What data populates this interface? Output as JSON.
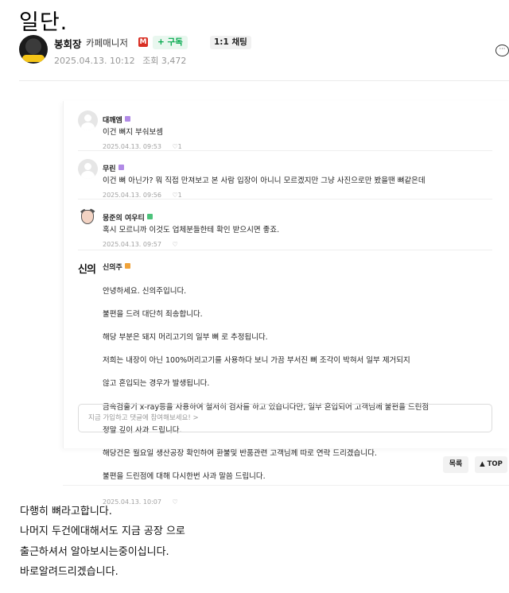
{
  "post": {
    "title": "일단.",
    "author": {
      "name": "봉회장",
      "grade": "카페매니저",
      "manager_badge": "M",
      "subscribe_label": "+ 구독",
      "chat_label": "1:1 채팅",
      "date": "2025.04.13. 10:12",
      "views_label": "조회 3,472"
    }
  },
  "embed": {
    "comments": [
      {
        "name": "대깨엠",
        "badge_color": "#b18ae6",
        "text": "이건 뼈지 부숴보셈",
        "date": "2025.04.13. 09:53",
        "likes": "1"
      },
      {
        "name": "무린",
        "badge_color": "#b18ae6",
        "text": "이건 뼈 아닌가? 뭐 직접 만져보고 본 사람 입장이 아니니 모르겠지만 그냥 사진으로만 봤을땐 뼈같은데",
        "date": "2025.04.13. 09:56",
        "likes": "1"
      },
      {
        "name": "몽준의 여우티",
        "badge_color": "#4cc37b",
        "text": "혹시 모르니까 이것도 업체분들한테 확인 받으시면 좋죠.",
        "date": "2025.04.13. 09:57",
        "likes": ""
      },
      {
        "name": "신의주",
        "badge_color": "#f0a33a",
        "lines": [
          "안녕하세요. 신의주입니다.",
          "불편을 드려 대단히 죄송합니다.",
          "해당 부분은 돼지 머리고기의 일부 뼈 로 추정됩니다.",
          "저희는 내장이 아닌 100%머리고기를 사용하다 보니 가끔 부서진 뼈 조각이 박혀서 일부 제거되지",
          "않고 혼입되는 경우가 발생됩니다.",
          "금속검출기 x-ray등을 사용하여 철저히 검사를 하고 있습니다만, 일부 혼입되어 고객님께 불편을 드린점",
          "정말 깊이 사과 드립니다.",
          "해당건은 월요일 생산공장 확인하여 환불및 반품관련 고객님께 따로 연락 드리겠습니다.",
          "불편을 드린점에 대해 다시한번 사과 말씀 드립니다."
        ],
        "date": "2025.04.13. 10:07",
        "likes": ""
      }
    ],
    "input_placeholder": "지금 가입하고 댓글에 참여해보세요! >"
  },
  "buttons": {
    "list_label": "목록",
    "top_label": "▲ TOP"
  },
  "body": {
    "lines": [
      "다행히 뼈라고합니다.",
      "나머지 두건에대해서도 지금 공장 으로",
      "출근하셔서 알아보시는중이십니다.",
      "바로알려드리겠습니다."
    ]
  },
  "icons": {
    "heart": "♡",
    "comment": "comment-bubble-icon"
  }
}
